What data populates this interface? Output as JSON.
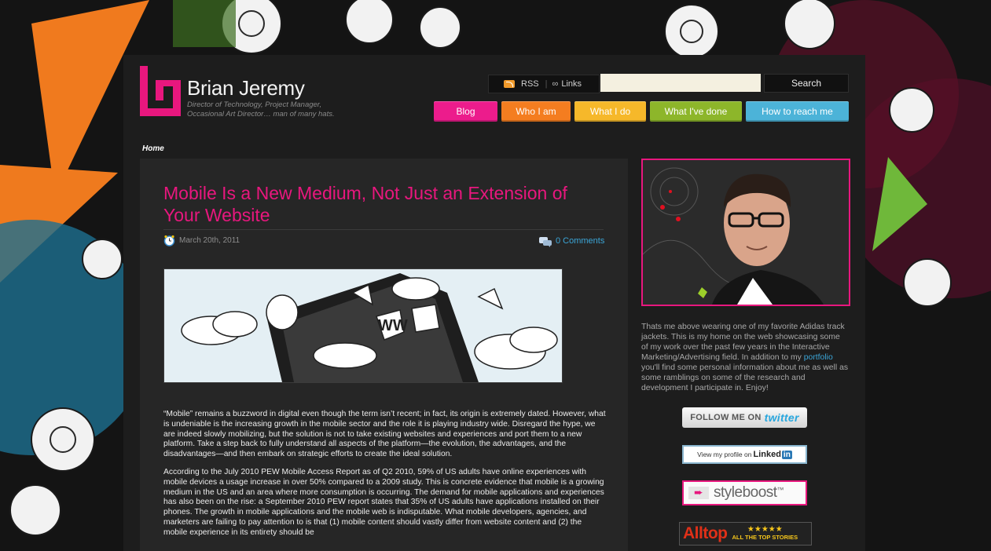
{
  "header": {
    "site_title": "Brian Jeremy",
    "tagline": "Director of Technology, Project Manager, Occasional Art Director… man of many hats.",
    "rss_label": "RSS",
    "links_label": "Links",
    "search_placeholder": "",
    "search_button": "Search"
  },
  "nav": {
    "items": [
      {
        "label": "Blog",
        "color": "#ec1c8c"
      },
      {
        "label": "Who I am",
        "color": "#f47d20"
      },
      {
        "label": "What I do",
        "color": "#f6b82a"
      },
      {
        "label": "What I've done",
        "color": "#8db62a"
      },
      {
        "label": "How to reach me",
        "color": "#4cb3d8"
      }
    ]
  },
  "breadcrumb": "Home",
  "post": {
    "title": "Mobile Is a New Medium, Not Just an Extension of Your Website",
    "date": "March 20th, 2011",
    "comments": "0 Comments",
    "paragraphs": [
      "“Mobile” remains a buzzword in digital even though the term isn’t recent; in fact, its origin is extremely dated. However, what is undeniable is the increasing growth in the mobile sector and the role it is playing industry wide. Disregard the hype, we are indeed slowly mobilizing, but the solution is not to take existing websites and experiences and port them to a new platform. Take a step back to fully understand all aspects of the platform—the evolution, the advantages, and the disadvantages—and then embark on strategic efforts to create the ideal solution.",
      "According to the July 2010 PEW Mobile Access Report as of Q2 2010, 59% of US adults have online experiences with mobile devices a usage increase in over 50% compared to a 2009 study. This is concrete evidence that mobile is a growing medium in the US and an area where more consumption is occurring. The demand for mobile applications and experiences has also been on the rise: a September 2010 PEW report states that 35% of US adults have applications installed on their phones. The growth in mobile applications and the mobile web is indisputable. What mobile developers, agencies, and marketers are failing to pay attention to is that (1) mobile content should vastly differ from website content and (2) the mobile experience in its entirety should be"
    ]
  },
  "sidebar": {
    "text_before": "Thats me above wearing one of my favorite Adidas track jackets. This is my home on the web showcasing some of my work over the past few years in the Interactive Marketing/Advertising field. In addition to my ",
    "portfolio_link": "portfolio",
    "text_after": " you'll find some personal information about me as well as some ramblings on some of the research and development I participate in. Enjoy!",
    "twitter_prefix": "FOLLOW ME ON",
    "twitter_word": "twitter",
    "linkedin_prefix": "View my profile on",
    "linkedin_word": "Linked",
    "linkedin_in": "in",
    "styleboost_word": "styleboost",
    "styleboost_tm": "™",
    "alltop_word": "Alltop",
    "alltop_stars": "★★★★★",
    "alltop_tag": "ALL THE TOP STORIES"
  },
  "colors": {
    "accent": "#e8177e",
    "link": "#3ba6d8"
  }
}
